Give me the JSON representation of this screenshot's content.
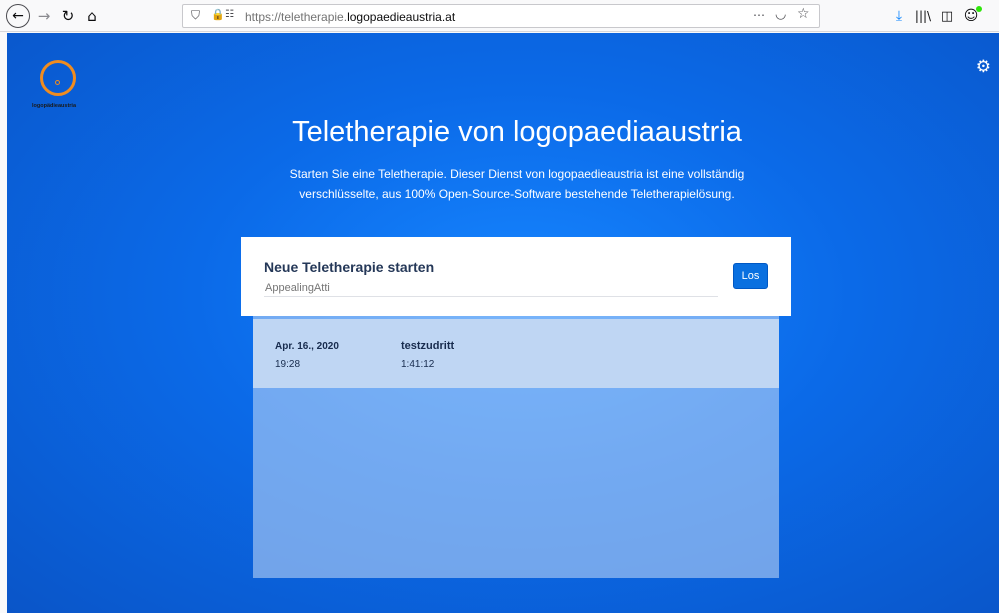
{
  "browser": {
    "back_icon": "←",
    "forward_icon": "→",
    "reload_icon": "↻",
    "home_icon": "⌂",
    "url_prefix": "https://teletherapie.",
    "url_domain": "logopaedieaustria.at",
    "icons": [
      "shield-icon",
      "lock-icon",
      "permissions-icon",
      "more-icon",
      "pocket-icon",
      "star-icon",
      "download-icon",
      "library-icon",
      "sidebar-icon",
      "account-icon"
    ]
  },
  "logo": {
    "text": "logopädieaustria",
    "ring_color": "#f08c1f"
  },
  "header": {
    "title": "Teletherapie von logopaediaaustria",
    "subtitle_line1": "Starten Sie eine Teletherapie. Dieser Dienst von logopaedieaustria ist eine vollständig",
    "subtitle_line2": "verschlüsselte, aus 100% Open-Source-Software bestehende Teletherapielösung."
  },
  "start_card": {
    "title": "Neue Teletherapie starten",
    "placeholder": "AppealingAtti",
    "go_label": "Los"
  },
  "recent": [
    {
      "date": "Apr. 16., 2020",
      "time": "19:28",
      "name": "testzudritt",
      "duration": "1:41:12"
    }
  ],
  "colors": {
    "background": "#0b6ae8",
    "accent": "#0a70e0"
  }
}
